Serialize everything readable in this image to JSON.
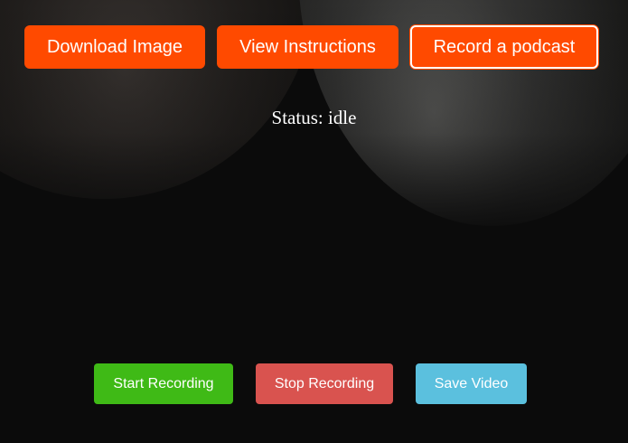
{
  "top_buttons": {
    "download_label": "Download Image",
    "instructions_label": "View Instructions",
    "podcast_label": "Record a podcast"
  },
  "status": {
    "prefix": "Status:",
    "value": "idle"
  },
  "recording_controls": {
    "start_label": "Start Recording",
    "stop_label": "Stop Recording",
    "save_label": "Save Video"
  },
  "colors": {
    "primary_orange": "#ff4a00",
    "start_green": "#3fba16",
    "stop_red": "#d9534f",
    "save_blue": "#5bc0de",
    "background": "#0b0b0b"
  }
}
